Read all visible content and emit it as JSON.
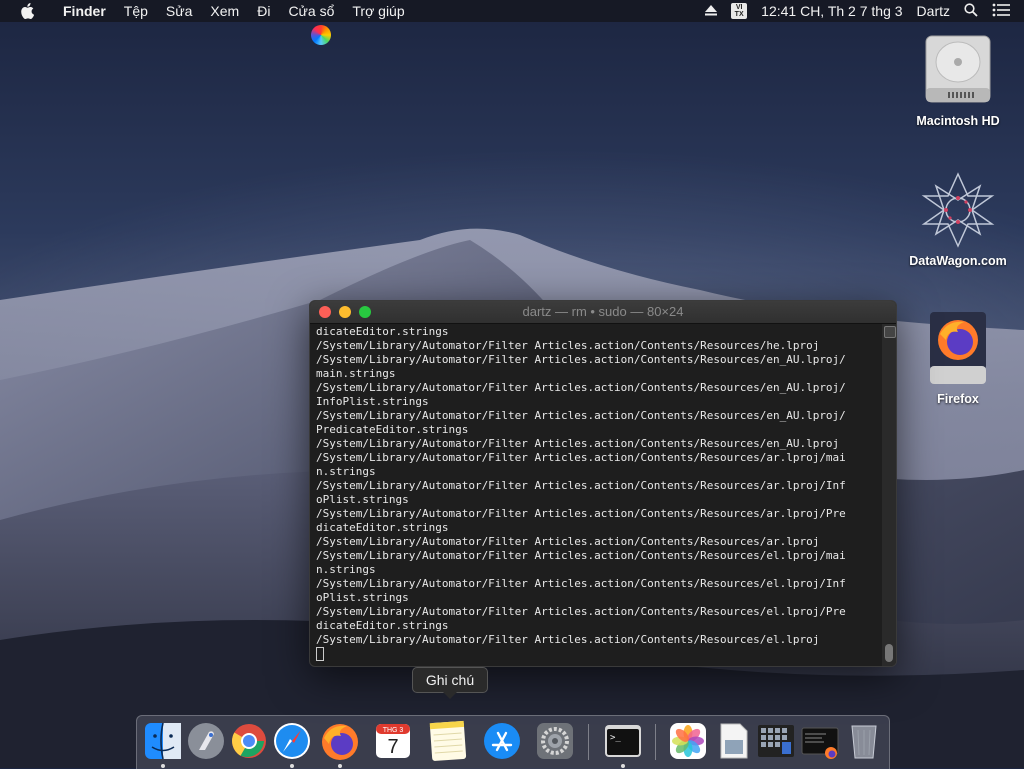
{
  "menubar": {
    "app_name": "Finder",
    "items": [
      "Tệp",
      "Sửa",
      "Xem",
      "Đi",
      "Cửa sổ",
      "Trợ giúp"
    ],
    "input_badge_top": "VI",
    "input_badge_bottom": "TX",
    "clock": "12:41 CH, Th 2 7 thg 3",
    "user": "Dartz"
  },
  "desktop": {
    "icons": [
      {
        "label": "Macintosh HD",
        "icon": "hard-drive-icon"
      },
      {
        "label": "DataWagon.com",
        "icon": "datawagon-icon"
      },
      {
        "label": "Firefox",
        "icon": "firefox-disk-icon"
      }
    ]
  },
  "terminal": {
    "title": "dartz — rm • sudo — 80×24",
    "lines": [
      "dicateEditor.strings",
      "/System/Library/Automator/Filter Articles.action/Contents/Resources/he.lproj",
      "/System/Library/Automator/Filter Articles.action/Contents/Resources/en_AU.lproj/",
      "main.strings",
      "/System/Library/Automator/Filter Articles.action/Contents/Resources/en_AU.lproj/",
      "InfoPlist.strings",
      "/System/Library/Automator/Filter Articles.action/Contents/Resources/en_AU.lproj/",
      "PredicateEditor.strings",
      "/System/Library/Automator/Filter Articles.action/Contents/Resources/en_AU.lproj",
      "/System/Library/Automator/Filter Articles.action/Contents/Resources/ar.lproj/mai",
      "n.strings",
      "/System/Library/Automator/Filter Articles.action/Contents/Resources/ar.lproj/Inf",
      "oPlist.strings",
      "/System/Library/Automator/Filter Articles.action/Contents/Resources/ar.lproj/Pre",
      "dicateEditor.strings",
      "/System/Library/Automator/Filter Articles.action/Contents/Resources/ar.lproj",
      "/System/Library/Automator/Filter Articles.action/Contents/Resources/el.lproj/mai",
      "n.strings",
      "/System/Library/Automator/Filter Articles.action/Contents/Resources/el.lproj/Inf",
      "oPlist.strings",
      "/System/Library/Automator/Filter Articles.action/Contents/Resources/el.lproj/Pre",
      "dicateEditor.strings",
      "/System/Library/Automator/Filter Articles.action/Contents/Resources/el.lproj"
    ]
  },
  "tooltip": {
    "text": "Ghi chú"
  },
  "dock": {
    "calendar_month": "THG 3",
    "calendar_day": "7",
    "items": [
      {
        "name": "finder",
        "running": true
      },
      {
        "name": "launchpad",
        "running": false
      },
      {
        "name": "chrome",
        "running": false
      },
      {
        "name": "safari",
        "running": true
      },
      {
        "name": "firefox",
        "running": true
      },
      {
        "name": "calendar",
        "running": false
      },
      {
        "name": "notes",
        "running": false
      },
      {
        "name": "app-store",
        "running": false
      },
      {
        "name": "system-preferences",
        "running": false
      },
      {
        "name": "terminal",
        "running": true
      },
      {
        "name": "photos",
        "running": false
      },
      {
        "name": "preview",
        "running": false
      },
      {
        "name": "screenshot",
        "running": false
      },
      {
        "name": "terminal-firefox",
        "running": false
      },
      {
        "name": "trash",
        "running": false
      }
    ]
  }
}
